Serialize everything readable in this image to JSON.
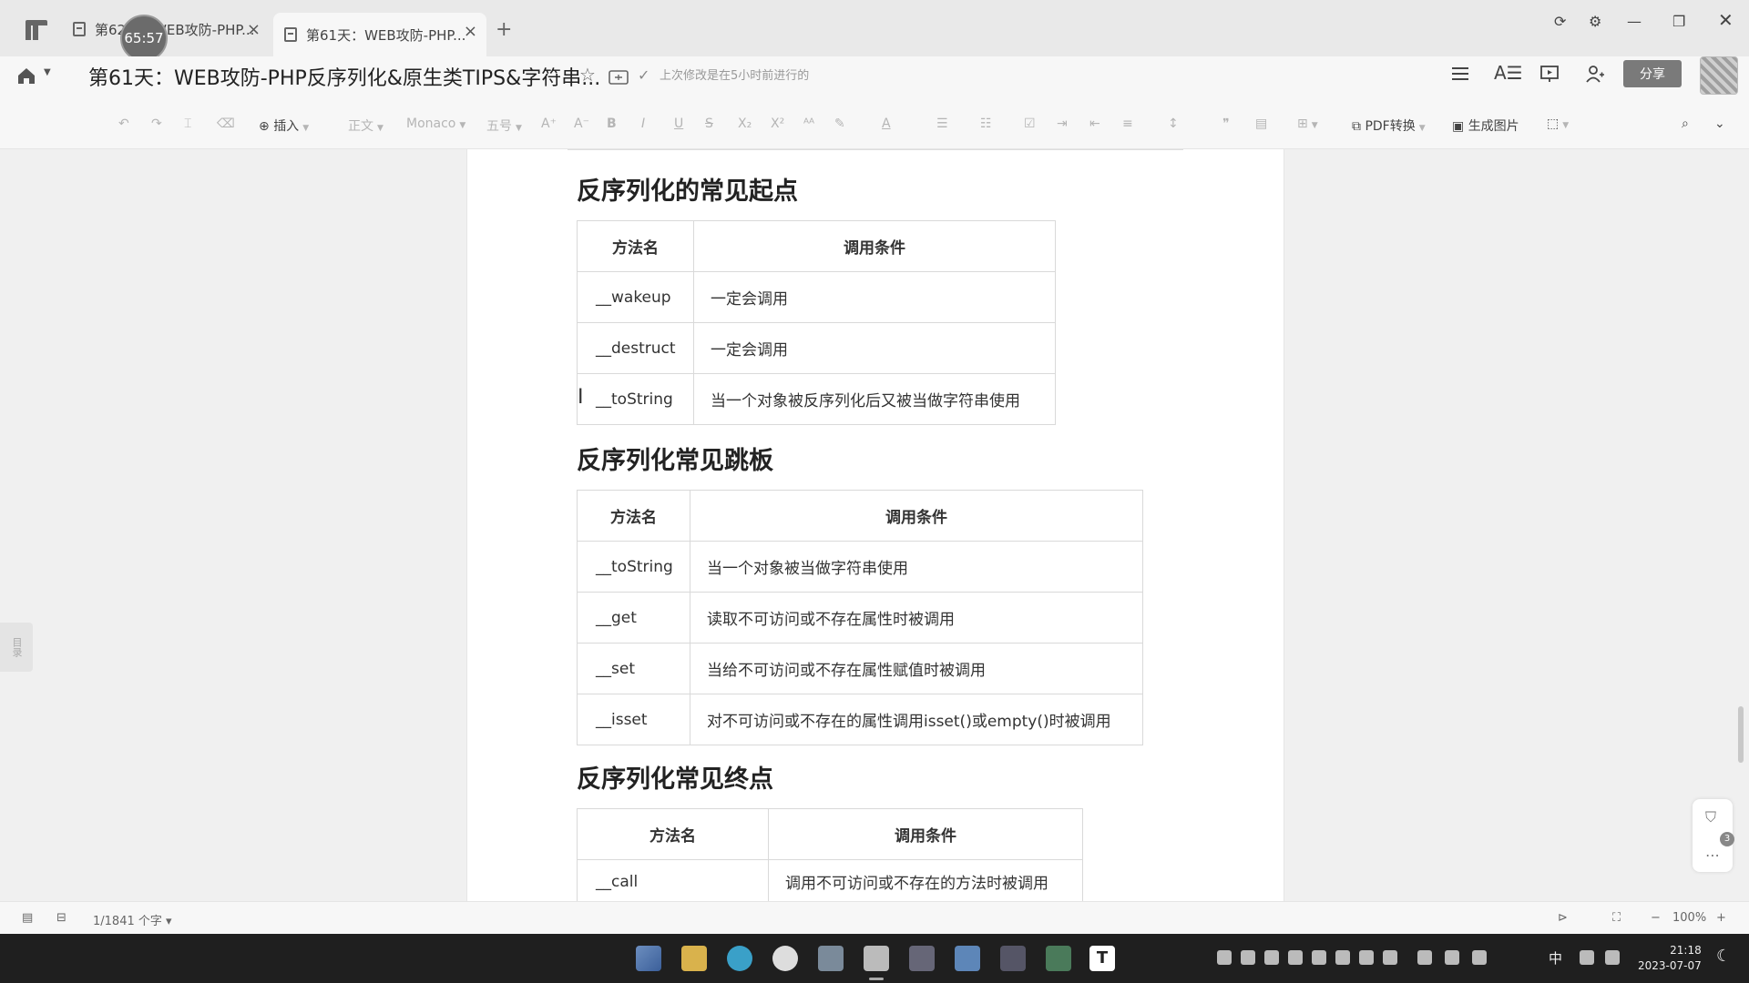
{
  "tabs": [
    {
      "label": "第62天：WEB攻防-PHP...",
      "active": false
    },
    {
      "label": "第61天：WEB攻防-PHP...",
      "active": true
    }
  ],
  "timer_badge": "65:57",
  "header": {
    "doc_title": "第61天：WEB攻防-PHP反序列化&原生类TIPS&字符串...",
    "save_status": "上次修改是在5小时前进行的",
    "share_label": "分享"
  },
  "toolbar": {
    "insert": "插入",
    "style": "正文",
    "font": "Monaco",
    "size": "五号",
    "pdf": "PDF转换",
    "image": "生成图片"
  },
  "outline_tab": "目录",
  "sections": [
    {
      "title": "反序列化的常见起点",
      "headers": [
        "方法名",
        "调用条件"
      ],
      "rows": [
        {
          "method": "__wakeup",
          "condition": "一定会调用"
        },
        {
          "method": "__destruct",
          "condition": "一定会调用"
        },
        {
          "method": "__toString",
          "condition": "当一个对象被反序列化后又被当做字符串使用"
        }
      ]
    },
    {
      "title": "反序列化常见跳板",
      "headers": [
        "方法名",
        "调用条件"
      ],
      "rows": [
        {
          "method": "__toString",
          "condition": "当一个对象被当做字符串使用"
        },
        {
          "method": "__get",
          "condition": "读取不可访问或不存在属性时被调用"
        },
        {
          "method": "__set",
          "condition": "当给不可访问或不存在属性赋值时被调用"
        },
        {
          "method": "__isset",
          "condition": "对不可访问或不存在的属性调用isset()或empty()时被调用"
        }
      ]
    },
    {
      "title": "反序列化常见终点",
      "headers": [
        "方法名",
        "调用条件"
      ],
      "rows": [
        {
          "method": "__call",
          "condition": "调用不可访问或不存在的方法时被调用"
        }
      ]
    }
  ],
  "side_float_badge": "3",
  "statusbar": {
    "word_count": "1/1841 个字",
    "zoom": "100%"
  },
  "clock": {
    "time": "21:18",
    "date": "2023-07-07"
  },
  "tray_ime": "中",
  "colors": {
    "accent": "#7a7a7a",
    "taskbar": "#1f1f1f",
    "page": "#ffffff"
  }
}
